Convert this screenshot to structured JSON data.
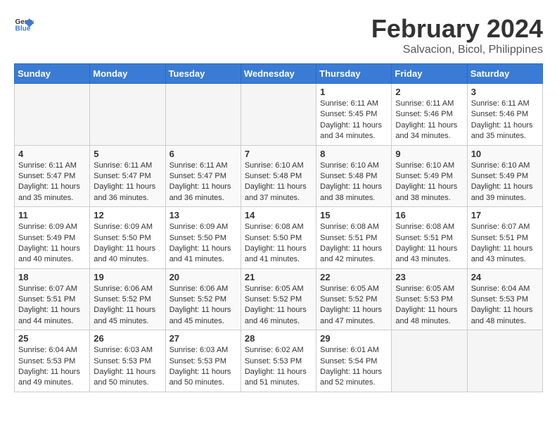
{
  "header": {
    "logo_general": "General",
    "logo_blue": "Blue",
    "title": "February 2024",
    "subtitle": "Salvacion, Bicol, Philippines"
  },
  "calendar": {
    "days_of_week": [
      "Sunday",
      "Monday",
      "Tuesday",
      "Wednesday",
      "Thursday",
      "Friday",
      "Saturday"
    ],
    "weeks": [
      [
        {
          "day": "",
          "info": ""
        },
        {
          "day": "",
          "info": ""
        },
        {
          "day": "",
          "info": ""
        },
        {
          "day": "",
          "info": ""
        },
        {
          "day": "1",
          "info": "Sunrise: 6:11 AM\nSunset: 5:45 PM\nDaylight: 11 hours\nand 34 minutes."
        },
        {
          "day": "2",
          "info": "Sunrise: 6:11 AM\nSunset: 5:46 PM\nDaylight: 11 hours\nand 34 minutes."
        },
        {
          "day": "3",
          "info": "Sunrise: 6:11 AM\nSunset: 5:46 PM\nDaylight: 11 hours\nand 35 minutes."
        }
      ],
      [
        {
          "day": "4",
          "info": "Sunrise: 6:11 AM\nSunset: 5:47 PM\nDaylight: 11 hours\nand 35 minutes."
        },
        {
          "day": "5",
          "info": "Sunrise: 6:11 AM\nSunset: 5:47 PM\nDaylight: 11 hours\nand 36 minutes."
        },
        {
          "day": "6",
          "info": "Sunrise: 6:11 AM\nSunset: 5:47 PM\nDaylight: 11 hours\nand 36 minutes."
        },
        {
          "day": "7",
          "info": "Sunrise: 6:10 AM\nSunset: 5:48 PM\nDaylight: 11 hours\nand 37 minutes."
        },
        {
          "day": "8",
          "info": "Sunrise: 6:10 AM\nSunset: 5:48 PM\nDaylight: 11 hours\nand 38 minutes."
        },
        {
          "day": "9",
          "info": "Sunrise: 6:10 AM\nSunset: 5:49 PM\nDaylight: 11 hours\nand 38 minutes."
        },
        {
          "day": "10",
          "info": "Sunrise: 6:10 AM\nSunset: 5:49 PM\nDaylight: 11 hours\nand 39 minutes."
        }
      ],
      [
        {
          "day": "11",
          "info": "Sunrise: 6:09 AM\nSunset: 5:49 PM\nDaylight: 11 hours\nand 40 minutes."
        },
        {
          "day": "12",
          "info": "Sunrise: 6:09 AM\nSunset: 5:50 PM\nDaylight: 11 hours\nand 40 minutes."
        },
        {
          "day": "13",
          "info": "Sunrise: 6:09 AM\nSunset: 5:50 PM\nDaylight: 11 hours\nand 41 minutes."
        },
        {
          "day": "14",
          "info": "Sunrise: 6:08 AM\nSunset: 5:50 PM\nDaylight: 11 hours\nand 41 minutes."
        },
        {
          "day": "15",
          "info": "Sunrise: 6:08 AM\nSunset: 5:51 PM\nDaylight: 11 hours\nand 42 minutes."
        },
        {
          "day": "16",
          "info": "Sunrise: 6:08 AM\nSunset: 5:51 PM\nDaylight: 11 hours\nand 43 minutes."
        },
        {
          "day": "17",
          "info": "Sunrise: 6:07 AM\nSunset: 5:51 PM\nDaylight: 11 hours\nand 43 minutes."
        }
      ],
      [
        {
          "day": "18",
          "info": "Sunrise: 6:07 AM\nSunset: 5:51 PM\nDaylight: 11 hours\nand 44 minutes."
        },
        {
          "day": "19",
          "info": "Sunrise: 6:06 AM\nSunset: 5:52 PM\nDaylight: 11 hours\nand 45 minutes."
        },
        {
          "day": "20",
          "info": "Sunrise: 6:06 AM\nSunset: 5:52 PM\nDaylight: 11 hours\nand 45 minutes."
        },
        {
          "day": "21",
          "info": "Sunrise: 6:05 AM\nSunset: 5:52 PM\nDaylight: 11 hours\nand 46 minutes."
        },
        {
          "day": "22",
          "info": "Sunrise: 6:05 AM\nSunset: 5:52 PM\nDaylight: 11 hours\nand 47 minutes."
        },
        {
          "day": "23",
          "info": "Sunrise: 6:05 AM\nSunset: 5:53 PM\nDaylight: 11 hours\nand 48 minutes."
        },
        {
          "day": "24",
          "info": "Sunrise: 6:04 AM\nSunset: 5:53 PM\nDaylight: 11 hours\nand 48 minutes."
        }
      ],
      [
        {
          "day": "25",
          "info": "Sunrise: 6:04 AM\nSunset: 5:53 PM\nDaylight: 11 hours\nand 49 minutes."
        },
        {
          "day": "26",
          "info": "Sunrise: 6:03 AM\nSunset: 5:53 PM\nDaylight: 11 hours\nand 50 minutes."
        },
        {
          "day": "27",
          "info": "Sunrise: 6:03 AM\nSunset: 5:53 PM\nDaylight: 11 hours\nand 50 minutes."
        },
        {
          "day": "28",
          "info": "Sunrise: 6:02 AM\nSunset: 5:53 PM\nDaylight: 11 hours\nand 51 minutes."
        },
        {
          "day": "29",
          "info": "Sunrise: 6:01 AM\nSunset: 5:54 PM\nDaylight: 11 hours\nand 52 minutes."
        },
        {
          "day": "",
          "info": ""
        },
        {
          "day": "",
          "info": ""
        }
      ]
    ]
  }
}
